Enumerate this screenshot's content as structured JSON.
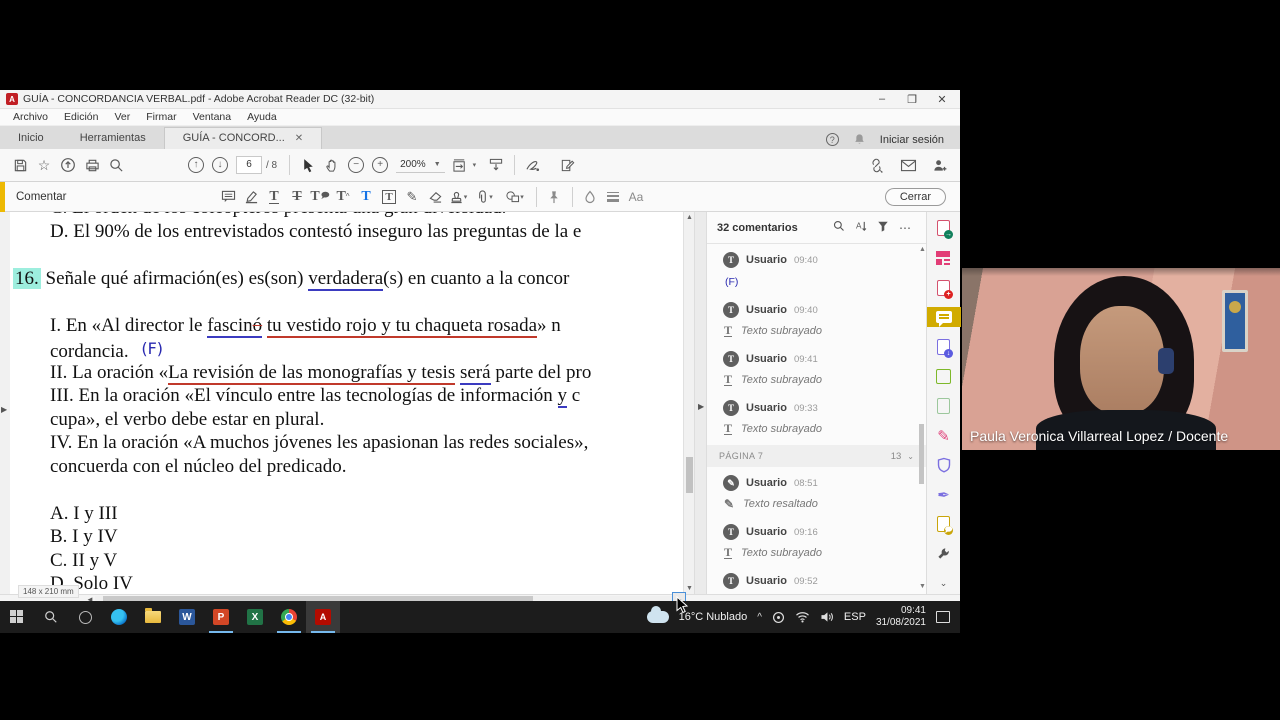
{
  "colors": {
    "comment_accent_yellow": "#edb903",
    "selected_tool_yellow": "#d1ab00",
    "underline_red": "#c0392b",
    "underline_blue": "#3b3bc0",
    "question_highlight_cyan": "#9deede",
    "acrobat_red": "#b30b00"
  },
  "titlebar": {
    "title": "GUÍA - CONCORDANCIA VERBAL.pdf - Adobe Acrobat Reader DC (32-bit)",
    "minimize": "–",
    "maximize": "❐",
    "close": "✕"
  },
  "menubar": {
    "items": [
      "Archivo",
      "Edición",
      "Ver",
      "Firmar",
      "Ventana",
      "Ayuda"
    ]
  },
  "tabbar": {
    "tab_inicio": "Inicio",
    "tab_herramientas": "Herramientas",
    "tab_doc": "GUÍA - CONCORD...",
    "tab_doc_close": "✕",
    "help": "?",
    "sign_in": "Iniciar sesión"
  },
  "toolbar": {
    "page_num": "6",
    "page_total": "/ 8",
    "zoom": "200%"
  },
  "commentbar": {
    "label": "Comentar",
    "text_style": "Aa",
    "close": "Cerrar"
  },
  "pdf": {
    "line_c": "C. El orden de los coleópteros presenta una gran diversidad.",
    "line_d": "D. El 90% de los entrevistados contestó inseguro las preguntas de la e",
    "q_num": "16.",
    "q_pre": " Señale qué afirmación(es) es(son) ",
    "q_u": "verdadera",
    "q_post": "(s) en cuanto a la concor",
    "i_pre": "I. En «Al director le ",
    "i_u1": "fascin",
    "i_u1b": "ó",
    "i_gap": " ",
    "i_u2": "tu vestido rojo y tu chaqueta rosada",
    "i_post": "» n",
    "cord": "cordancia. ",
    "cord_note": "(F)",
    "ii_pre": "II. La oración «",
    "ii_u1": "La revisión de las monografías y tesis",
    "ii_gap": " ",
    "ii_u2": "será",
    "ii_post": " parte del pro",
    "iii_pre": "III. En la oración «El vínculo entre las tecnologías de información ",
    "iii_u": "y",
    "iii_post": " c",
    "cupa": "cupa», el verbo debe estar en plural.",
    "iv": "IV. En la oración «A muchos jóvenes les apasionan las redes sociales»,",
    "concuerda": "concuerda con el núcleo del predicado.",
    "opt_a": "A. I y III",
    "opt_b": "B. I y IV",
    "opt_c": "C. II y V",
    "opt_d": "D. Solo IV",
    "page_size": "148 x 210 mm"
  },
  "comments": {
    "header": "32 comentarios",
    "page_divider": {
      "label": "PÁGINA 7",
      "count": "13",
      "chevron": "⌄"
    },
    "items": [
      {
        "user": "Usuario",
        "time": "09:40",
        "avatar": "T",
        "tool": "T",
        "text": "(F)"
      },
      {
        "user": "Usuario",
        "time": "09:40",
        "avatar": "T",
        "tool": "T",
        "text": "Texto subrayado"
      },
      {
        "user": "Usuario",
        "time": "09:41",
        "avatar": "T",
        "tool": "T",
        "text": "Texto subrayado"
      },
      {
        "user": "Usuario",
        "time": "09:33",
        "avatar": "T",
        "tool": "T",
        "text": "Texto subrayado"
      },
      {
        "user": "Usuario",
        "time": "08:51",
        "avatar": "✎",
        "tool": "✎",
        "text": "Texto resaltado"
      },
      {
        "user": "Usuario",
        "time": "09:16",
        "avatar": "T",
        "tool": "T",
        "text": "Texto subrayado"
      },
      {
        "user": "Usuario",
        "time": "09:52",
        "avatar": "T",
        "tool": "T",
        "text": ""
      }
    ]
  },
  "webcam": {
    "name_label": "Paula Veronica Villarreal Lopez / Docente"
  },
  "taskbar": {
    "weather": "16°C  Nublado",
    "tray_chevron": "^",
    "language": "ESP",
    "time": "09:41",
    "date": "31/08/2021"
  }
}
